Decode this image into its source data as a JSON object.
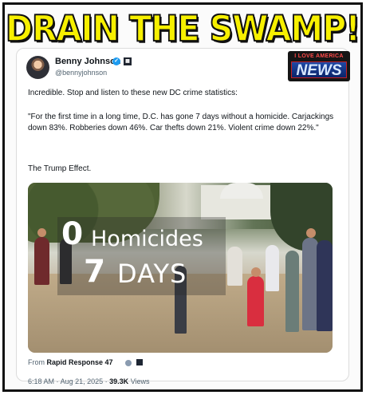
{
  "meme": {
    "headline": "DRAIN THE SWAMP!",
    "logo_top": "I LOVE AMERICA",
    "logo_main": "NEWS"
  },
  "tweet": {
    "author": "Benny Johnson",
    "handle": "@bennyjohnson",
    "line1": "Incredible. Stop and listen to these new DC crime statistics:",
    "quote": "\"For the first time in a long time, D.C. has gone 7 days without a homicide. Carjackings down 83%. Robberies down 46%. Car thefts down 21%. Violent crime down 22%.\"",
    "closing": "The Trump Effect.",
    "media": {
      "top_number": "0",
      "top_label": "Homicides",
      "bottom_number": "7",
      "bottom_label": "DAYS"
    },
    "source_prefix": "From",
    "source_name": "Rapid Response 47",
    "time": "6:18 AM",
    "separator": "·",
    "date": "Aug 21, 2025",
    "views_count": "39.3K",
    "views_label": "Views",
    "icons": {
      "verified": "verified-badge-icon",
      "affiliate": "affiliate-badge-icon"
    },
    "colors": {
      "headline_yellow": "#f7f000",
      "verified_blue": "#1d9bf0"
    }
  }
}
